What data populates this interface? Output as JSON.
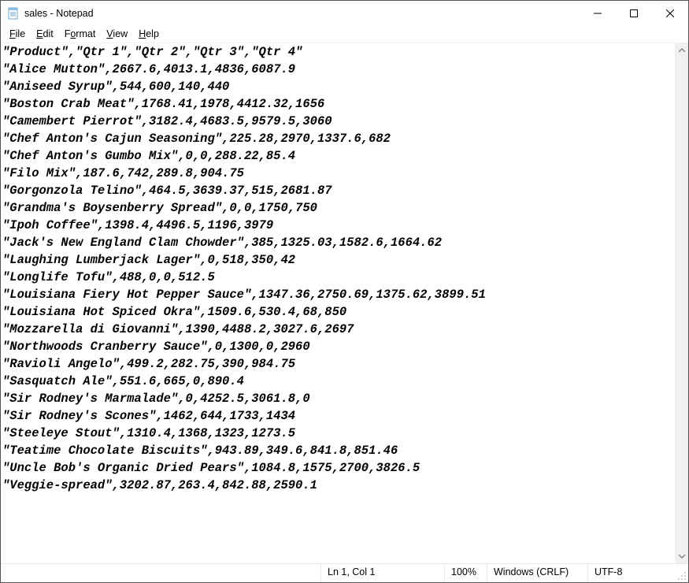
{
  "title": "sales - Notepad",
  "menu": {
    "file": "File",
    "edit": "Edit",
    "format": "Format",
    "view": "View",
    "help": "Help"
  },
  "content": "\"Product\",\"Qtr 1\",\"Qtr 2\",\"Qtr 3\",\"Qtr 4\"\n\"Alice Mutton\",2667.6,4013.1,4836,6087.9\n\"Aniseed Syrup\",544,600,140,440\n\"Boston Crab Meat\",1768.41,1978,4412.32,1656\n\"Camembert Pierrot\",3182.4,4683.5,9579.5,3060\n\"Chef Anton's Cajun Seasoning\",225.28,2970,1337.6,682\n\"Chef Anton's Gumbo Mix\",0,0,288.22,85.4\n\"Filo Mix\",187.6,742,289.8,904.75\n\"Gorgonzola Telino\",464.5,3639.37,515,2681.87\n\"Grandma's Boysenberry Spread\",0,0,1750,750\n\"Ipoh Coffee\",1398.4,4496.5,1196,3979\n\"Jack's New England Clam Chowder\",385,1325.03,1582.6,1664.62\n\"Laughing Lumberjack Lager\",0,518,350,42\n\"Longlife Tofu\",488,0,0,512.5\n\"Louisiana Fiery Hot Pepper Sauce\",1347.36,2750.69,1375.62,3899.51\n\"Louisiana Hot Spiced Okra\",1509.6,530.4,68,850\n\"Mozzarella di Giovanni\",1390,4488.2,3027.6,2697\n\"Northwoods Cranberry Sauce\",0,1300,0,2960\n\"Ravioli Angelo\",499.2,282.75,390,984.75\n\"Sasquatch Ale\",551.6,665,0,890.4\n\"Sir Rodney's Marmalade\",0,4252.5,3061.8,0\n\"Sir Rodney's Scones\",1462,644,1733,1434\n\"Steeleye Stout\",1310.4,1368,1323,1273.5\n\"Teatime Chocolate Biscuits\",943.89,349.6,841.8,851.46\n\"Uncle Bob's Organic Dried Pears\",1084.8,1575,2700,3826.5\n\"Veggie-spread\",3202.87,263.4,842.88,2590.1\n",
  "status": {
    "position": "Ln 1, Col 1",
    "zoom": "100%",
    "line_ending": "Windows (CRLF)",
    "encoding": "UTF-8"
  }
}
